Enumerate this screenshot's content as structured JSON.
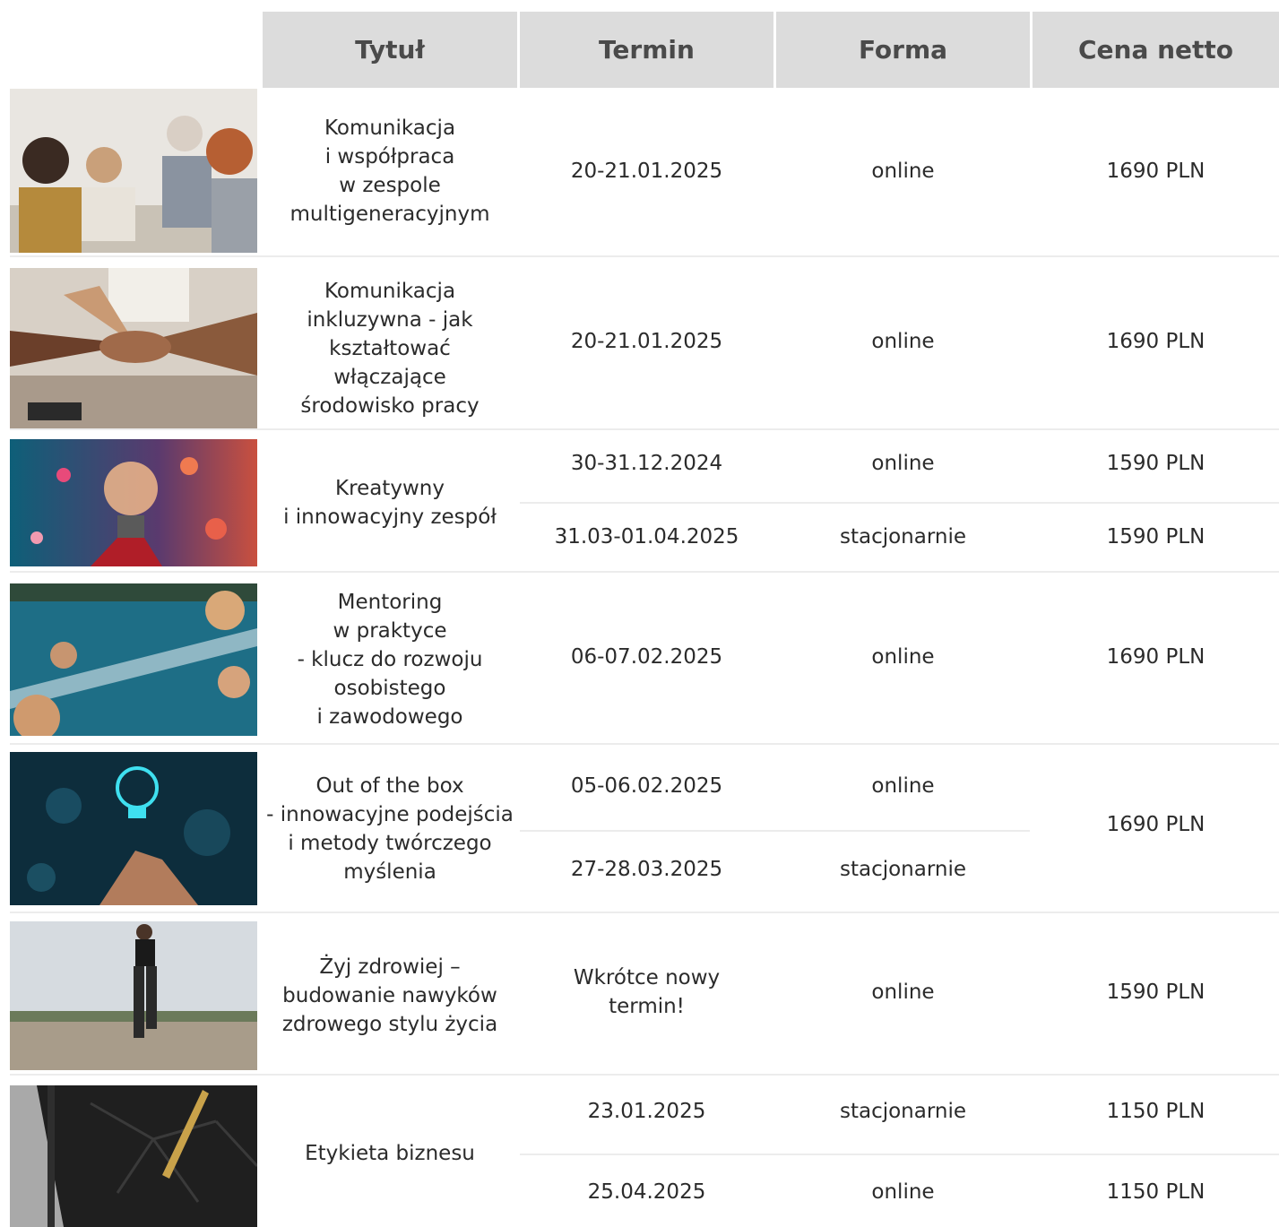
{
  "headers": {
    "title": "Tytuł",
    "date": "Termin",
    "form": "Forma",
    "price": "Cena netto"
  },
  "rows": [
    {
      "image": "team-meeting-photo",
      "title": "Komunikacja\ni współpraca\nw zespole\nmultigeneracyjnym",
      "sessions": [
        {
          "date": "20-21.01.2025",
          "form": "online",
          "price": "1690 PLN"
        }
      ]
    },
    {
      "image": "stacked-hands-photo",
      "title": "Komunikacja\ninkluzywna - jak\nkształtować\nwłączające\nśrodowisko pracy",
      "sessions": [
        {
          "date": "20-21.01.2025",
          "form": "online",
          "price": "1690 PLN"
        }
      ]
    },
    {
      "image": "light-bulb-photo",
      "title": "Kreatywny\ni innowacyjny zespół",
      "sessions": [
        {
          "date": "30-31.12.2024",
          "form": "online",
          "price": "1590 PLN"
        },
        {
          "date": "31.03-01.04.2025",
          "form": "stacjonarnie",
          "price": "1590 PLN"
        }
      ]
    },
    {
      "image": "aerial-bridge-photo",
      "title": "Mentoring\nw praktyce\n- klucz do rozwoju\nosobistego\ni zawodowego",
      "sessions": [
        {
          "date": "06-07.02.2025",
          "form": "online",
          "price": "1690 PLN"
        }
      ]
    },
    {
      "image": "glowing-bulb-hand-photo",
      "title": "Out of the box\n- innowacyjne podejścia\ni metody twórczego\nmyślenia",
      "sessions": [
        {
          "date": "05-06.02.2025",
          "form": "online"
        },
        {
          "date": "27-28.03.2025",
          "form": "stacjonarnie"
        }
      ],
      "price": "1690 PLN"
    },
    {
      "image": "runner-photo",
      "title": "Żyj zdrowiej –\nbudowanie nawyków\nzdrowego stylu życia",
      "sessions": [
        {
          "date": "Wkrótce nowy\ntermin!",
          "form": "online",
          "price": "1590 PLN"
        }
      ]
    },
    {
      "image": "notebook-pen-photo",
      "title": "Etykieta biznesu",
      "sessions": [
        {
          "date": "23.01.2025",
          "form": "stacjonarnie",
          "price": "1150 PLN"
        },
        {
          "date": "25.04.2025",
          "form": "online",
          "price": "1150 PLN"
        }
      ]
    }
  ]
}
